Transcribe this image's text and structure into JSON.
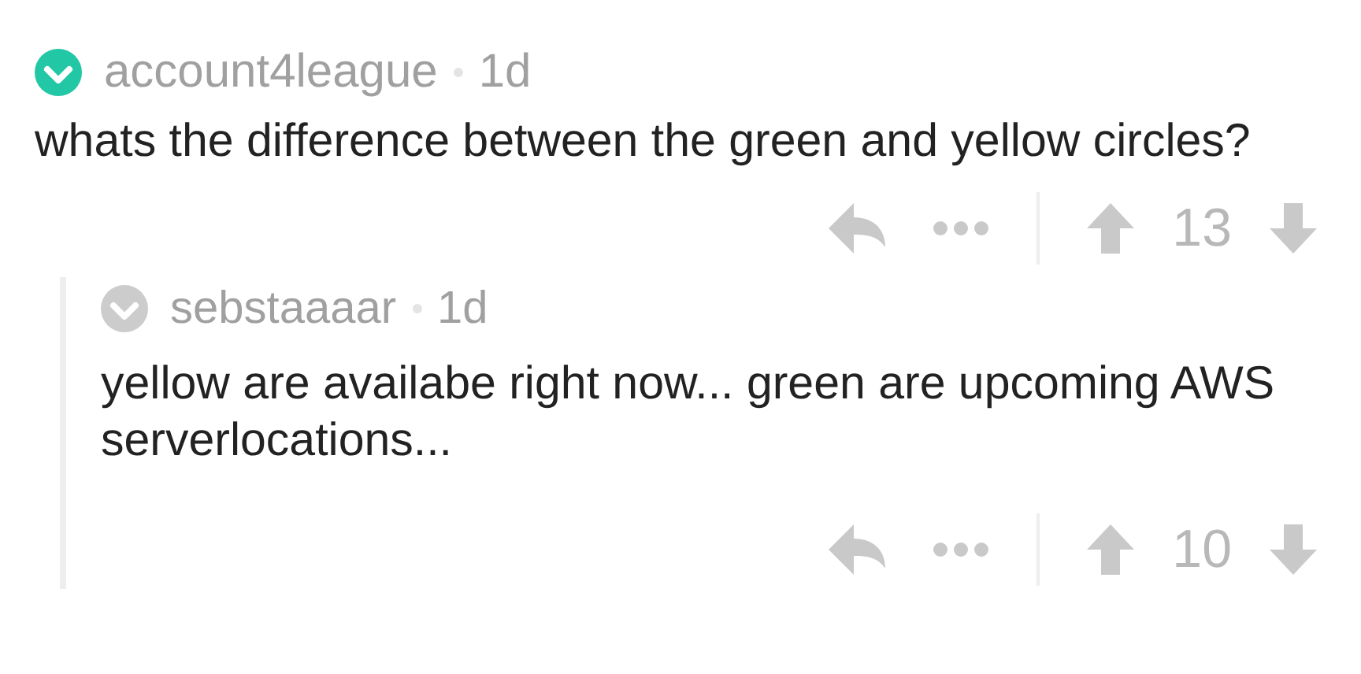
{
  "comments": [
    {
      "author": "account4league",
      "age": "1d",
      "color": "#22c7a6",
      "body": "whats the difference between the green and yellow circles?",
      "score": "13",
      "replies": [
        {
          "author": "sebstaaaar",
          "age": "1d",
          "color": "#cccccc",
          "body": "yellow are availabe right now... green are upcoming AWS serverlocations...",
          "score": "10"
        }
      ]
    }
  ]
}
